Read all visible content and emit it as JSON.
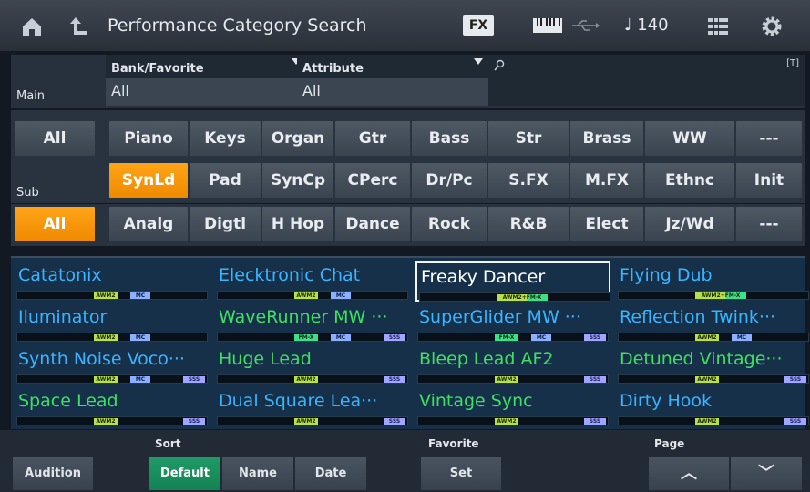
{
  "header": {
    "title": "Performance Category Search",
    "fx_label": "FX",
    "tempo": "♩ 140",
    "icons": [
      "home-icon",
      "back-icon",
      "keyboard-icon",
      "usb-icon",
      "quick-access-icon",
      "settings-icon"
    ]
  },
  "filters": {
    "bank_label": "Bank/Favorite",
    "bank_value": "All",
    "attribute_label": "Attribute",
    "attribute_value": "All",
    "search_badge": "[T]"
  },
  "main": {
    "label": "Main",
    "all": "All",
    "row1": [
      "Piano",
      "Keys",
      "Organ",
      "Gtr",
      "Bass",
      "Str",
      "Brass",
      "WW",
      "---"
    ],
    "row2": [
      "SynLd",
      "Pad",
      "SynCp",
      "CPerc",
      "Dr/Pc",
      "S.FX",
      "M.FX",
      "Ethnc",
      "Init"
    ]
  },
  "sub": {
    "label": "Sub",
    "all": "All",
    "row": [
      "Analg",
      "Digtl",
      "H Hop",
      "Dance",
      "Rock",
      "R&B",
      "Elect",
      "Jz/Wd",
      "---"
    ]
  },
  "results": [
    {
      "name": "Catatonix",
      "color": "#3ab4ff",
      "tags": [
        "AWM2",
        "MC"
      ]
    },
    {
      "name": "Elecktronic Chat",
      "color": "#3ab4ff",
      "tags": [
        "AWM2",
        "MC"
      ]
    },
    {
      "name": "Freaky Dancer",
      "color": "#ffffff",
      "tags": [
        "AWM2+FM-X"
      ],
      "selected": true
    },
    {
      "name": "Flying Dub",
      "color": "#3ab4ff",
      "tags": [
        "AWM2+FM-X"
      ]
    },
    {
      "name": "Iluminator",
      "color": "#3ab4ff",
      "tags": [
        "AWM2",
        "MC"
      ]
    },
    {
      "name": "WaveRunner MW ···",
      "color": "#3ee060",
      "tags": [
        "FM-X",
        "MC",
        "SSS"
      ]
    },
    {
      "name": "SuperGlider MW ···",
      "color": "#3ab4ff",
      "tags": [
        "FM-X",
        "MC",
        "SSS"
      ]
    },
    {
      "name": "Reflection Twink···",
      "color": "#3ab4ff",
      "tags": [
        "AWM2",
        "MC"
      ]
    },
    {
      "name": "Synth Noise Voco···",
      "color": "#3ab4ff",
      "tags": [
        "AWM2",
        "MC",
        "SSS"
      ]
    },
    {
      "name": "Huge Lead",
      "color": "#3ee060",
      "tags": [
        "AWM2",
        "SSS"
      ]
    },
    {
      "name": "Bleep Lead AF2",
      "color": "#3ee060",
      "tags": [
        "AWM2",
        "SSS"
      ]
    },
    {
      "name": "Detuned Vintage···",
      "color": "#3ee060",
      "tags": [
        "AWM2",
        "SSS"
      ]
    },
    {
      "name": "Space Lead",
      "color": "#3ee060",
      "tags": [
        "AWM2",
        "SSS"
      ]
    },
    {
      "name": "Dual Square Lea···",
      "color": "#3ab4ff",
      "tags": [
        "AWM2",
        "SSS"
      ]
    },
    {
      "name": "Vintage Sync",
      "color": "#3ee060",
      "tags": [
        "AWM2",
        "SSS"
      ]
    },
    {
      "name": "Dirty Hook",
      "color": "#3ab4ff",
      "tags": [
        "AWM2",
        "SSS"
      ]
    }
  ],
  "footer": {
    "audition": "Audition",
    "sort_label": "Sort",
    "sort_default": "Default",
    "sort_name": "Name",
    "sort_date": "Date",
    "favorite_label": "Favorite",
    "favorite_set": "Set",
    "page_label": "Page",
    "page_up": "︿",
    "page_down": "﹀"
  },
  "colors": {
    "accent_orange": "#f6950c",
    "selected_green": "#1a8f5c",
    "name_blue": "#3ab4ff",
    "name_green": "#3ee060"
  }
}
